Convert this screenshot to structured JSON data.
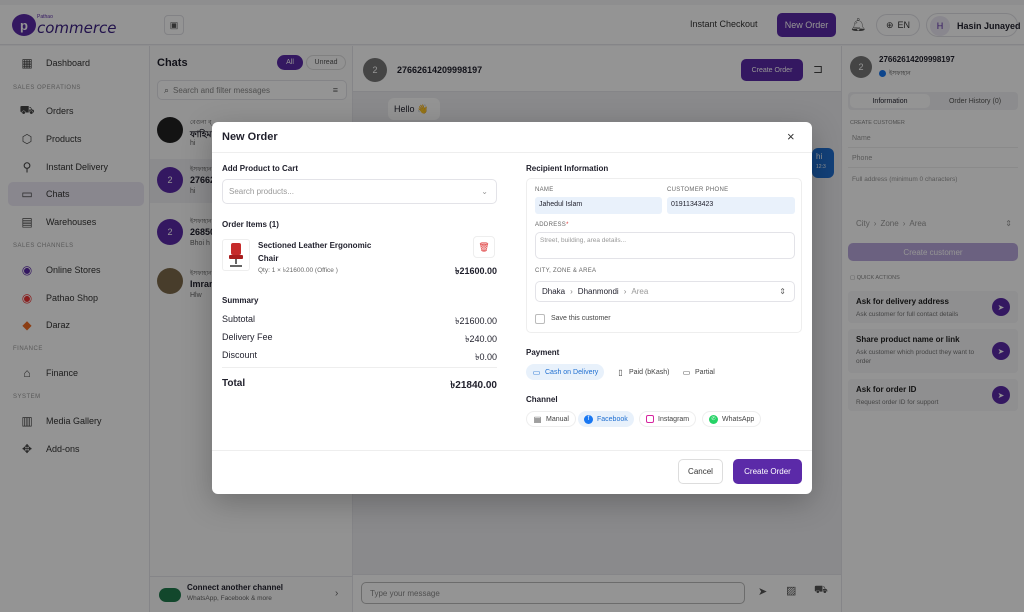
{
  "brand": {
    "small": "Pathao",
    "name": "commerce"
  },
  "topbar": {
    "instant_checkout": "Instant Checkout",
    "new_order": "New Order",
    "lang": "EN",
    "user_initial": "H",
    "user_name": "Hasin Junayed"
  },
  "sidebar": {
    "dashboard": "Dashboard",
    "sec_ops": "SALES OPERATIONS",
    "orders": "Orders",
    "products": "Products",
    "instant_delivery": "Instant Delivery",
    "chats": "Chats",
    "warehouses": "Warehouses",
    "sec_channels": "SALES CHANNELS",
    "online_stores": "Online Stores",
    "pathao_shop": "Pathao Shop",
    "daraz": "Daraz",
    "sec_finance": "FINANCE",
    "finance": "Finance",
    "sec_system": "SYSTEM",
    "media_gallery": "Media Gallery",
    "addons": "Add-ons",
    "connect_title": "Connect another channel",
    "connect_sub": "WhatsApp, Facebook & more"
  },
  "chatlist": {
    "title": "Chats",
    "tab_all": "All",
    "tab_unread": "Unread",
    "search_placeholder": "Search and filter messages",
    "items": [
      {
        "page": "বেগুনা ব্",
        "name": "ফাহিম",
        "preview": "hi"
      },
      {
        "page": "ইসফাহান",
        "name": "27662",
        "preview": "hi",
        "avatar": "2"
      },
      {
        "page": "ইসফাহান",
        "name": "26850",
        "preview": "Bhoi h",
        "avatar": "2"
      },
      {
        "page": "ইসফাহান",
        "name": "Imran",
        "preview": "Hlw"
      }
    ]
  },
  "chat": {
    "id": "27662614209998197",
    "avatar": "2",
    "create_order": "Create Order",
    "msg_hello": "Hello 👋",
    "msg_hi": "hi",
    "msg_time": "12:3",
    "input_placeholder": "Type your message"
  },
  "rpanel": {
    "id": "27662614209998197",
    "page": "ইসফাহান",
    "avatar": "2",
    "tab_info": "Information",
    "tab_history": "Order History (0)",
    "create_customer_head": "CREATE CUSTOMER",
    "name_ph": "Name",
    "phone_ph": "Phone",
    "address_ph": "Full address (minimum 0 characters)",
    "city": "City",
    "zone": "Zone",
    "area": "Area",
    "create_customer_btn": "Create customer",
    "quick_actions": "QUICK ACTIONS",
    "qa": [
      {
        "title": "Ask for delivery address",
        "desc": "Ask customer for full contact details"
      },
      {
        "title": "Share product name or link",
        "desc": "Ask customer which product they want to order"
      },
      {
        "title": "Ask for order ID",
        "desc": "Request order ID for support"
      }
    ]
  },
  "modal": {
    "title": "New Order",
    "add_product": "Add Product to Cart",
    "search_placeholder": "Search products...",
    "order_items": "Order Items (1)",
    "item": {
      "name": "Sectioned Leather Ergonomic Chair",
      "meta": "Qty: 1 × ৳21600.00  (Office )",
      "price": "৳21600.00"
    },
    "summary": "Summary",
    "subtotal_label": "Subtotal",
    "subtotal": "৳21600.00",
    "delivery_label": "Delivery Fee",
    "delivery": "৳240.00",
    "discount_label": "Discount",
    "discount": "৳0.00",
    "total_label": "Total",
    "total": "৳21840.00",
    "recipient": "Recipient Information",
    "name_label": "NAME",
    "name_value": "Jahedul Islam",
    "phone_label": "CUSTOMER PHONE",
    "phone_value": "01911343423",
    "address_label": "ADDRESS",
    "address_placeholder": "Street, building, area details...",
    "czarea_label": "CITY, ZONE & AREA",
    "city": "Dhaka",
    "zone": "Dhanmondi",
    "area": "Area",
    "save_customer": "Save this customer",
    "payment": "Payment",
    "pay_cod": "Cash on Delivery",
    "pay_bkash": "Paid (bKash)",
    "pay_partial": "Partial",
    "channel": "Channel",
    "ch_manual": "Manual",
    "ch_facebook": "Facebook",
    "ch_instagram": "Instagram",
    "ch_whatsapp": "WhatsApp",
    "cancel": "Cancel",
    "create": "Create Order"
  },
  "colors": {
    "accent": "#5b2aa8",
    "select_blue": "#1f6fd1",
    "danger": "#d33"
  }
}
